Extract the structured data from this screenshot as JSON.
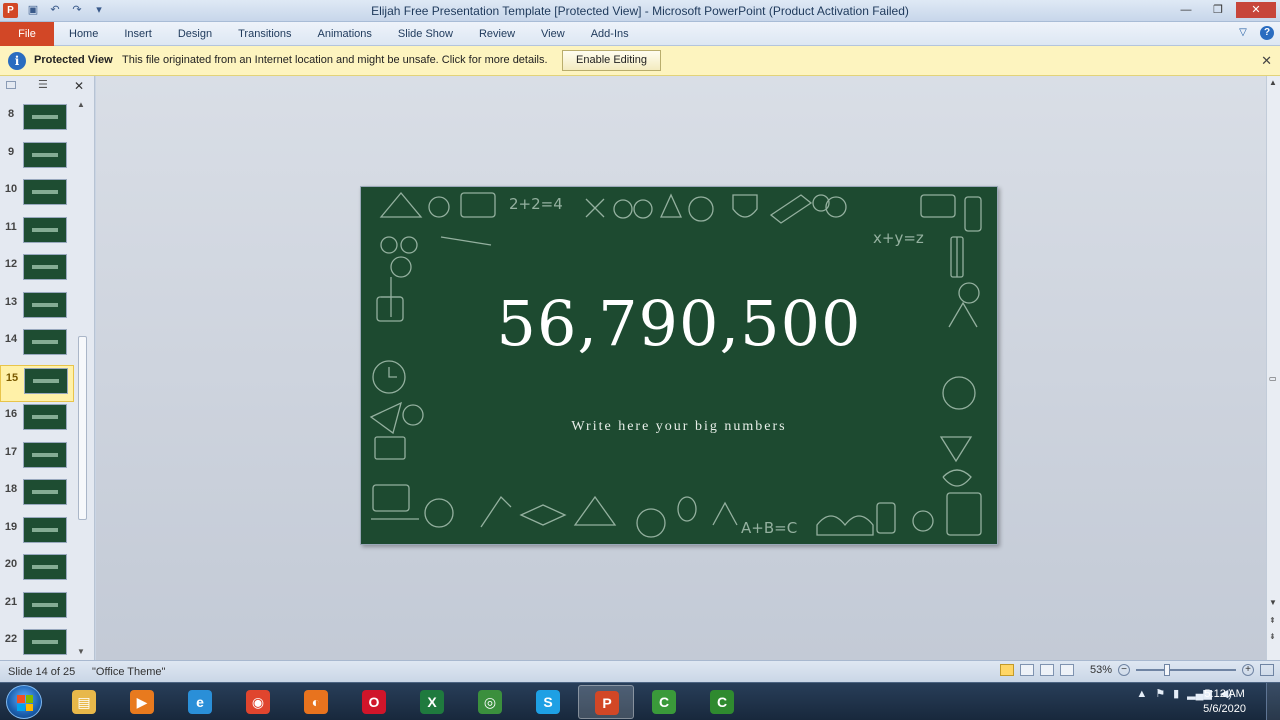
{
  "titlebar": {
    "app_icon": "P",
    "title": "Elijah Free Presentation Template [Protected View]  -  Microsoft PowerPoint (Product Activation Failed)",
    "minimize": "—",
    "restore": "❐",
    "close": "✕"
  },
  "ribbon": {
    "file_tab": "File",
    "tabs": [
      "Home",
      "Insert",
      "Design",
      "Transitions",
      "Animations",
      "Slide Show",
      "Review",
      "View",
      "Add-Ins"
    ],
    "collapse": "▽",
    "help": "?"
  },
  "protected_view": {
    "title": "Protected View",
    "message": "This file originated from an Internet location and might be unsafe. Click for more details.",
    "enable_button": "Enable Editing",
    "close": "✕"
  },
  "thumbnail_pane": {
    "close": "✕",
    "scroll_up": "▲",
    "scroll_down": "▼",
    "slides": [
      {
        "num": "8",
        "selected": false
      },
      {
        "num": "9",
        "selected": false
      },
      {
        "num": "10",
        "selected": false
      },
      {
        "num": "11",
        "selected": false
      },
      {
        "num": "12",
        "selected": false
      },
      {
        "num": "13",
        "selected": false
      },
      {
        "num": "14",
        "selected": false
      },
      {
        "num": "15",
        "selected": true
      },
      {
        "num": "16",
        "selected": false
      },
      {
        "num": "17",
        "selected": false
      },
      {
        "num": "18",
        "selected": false
      },
      {
        "num": "19",
        "selected": false
      },
      {
        "num": "20",
        "selected": false
      },
      {
        "num": "21",
        "selected": false
      },
      {
        "num": "22",
        "selected": false
      }
    ]
  },
  "slide": {
    "big_number": "56,790,500",
    "subtitle": "Write here your big numbers",
    "background_color": "#1d4a30"
  },
  "statusbar": {
    "slide_info": "Slide 14 of 25",
    "theme": "\"Office Theme\"",
    "zoom": "53%",
    "zoom_minus": "−",
    "zoom_plus": "+"
  },
  "taskbar": {
    "apps": [
      {
        "name": "file-explorer",
        "glyph": "▤",
        "color": "#e8b84a",
        "active": false
      },
      {
        "name": "media-player",
        "glyph": "▶",
        "color": "#e87a1e",
        "active": false
      },
      {
        "name": "internet-explorer",
        "glyph": "e",
        "color": "#2a8fd8",
        "active": false
      },
      {
        "name": "app-red",
        "glyph": "◉",
        "color": "#e0452e",
        "active": false
      },
      {
        "name": "firefox",
        "glyph": "◐",
        "color": "#e8731e",
        "active": false
      },
      {
        "name": "opera",
        "glyph": "O",
        "color": "#d0152a",
        "active": false
      },
      {
        "name": "excel",
        "glyph": "X",
        "color": "#1f7a3e",
        "active": false
      },
      {
        "name": "chrome",
        "glyph": "◎",
        "color": "#3b8f3d",
        "active": false
      },
      {
        "name": "skype",
        "glyph": "S",
        "color": "#1ea0e4",
        "active": false
      },
      {
        "name": "powerpoint",
        "glyph": "P",
        "color": "#d24726",
        "active": true
      },
      {
        "name": "camtasia-1",
        "glyph": "C",
        "color": "#3a9a3a",
        "active": false
      },
      {
        "name": "camtasia-2",
        "glyph": "C",
        "color": "#2f8a2f",
        "active": false
      }
    ],
    "tray_arrow": "▲",
    "time": "5:12 AM",
    "date": "5/6/2020"
  }
}
